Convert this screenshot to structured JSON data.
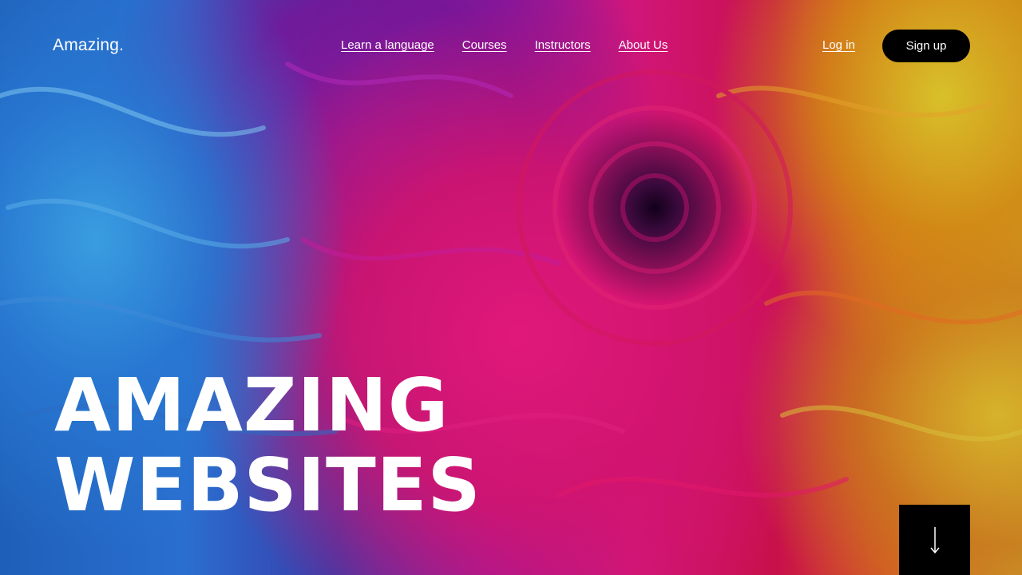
{
  "brand": {
    "logo_text": "Amazing."
  },
  "nav": {
    "items": [
      {
        "label": "Learn a language"
      },
      {
        "label": "Courses"
      },
      {
        "label": "Instructors"
      },
      {
        "label": "About Us"
      }
    ]
  },
  "auth": {
    "login_label": "Log in",
    "signup_label": "Sign up"
  },
  "hero": {
    "headline_line1": "AMAZING",
    "headline_line2": "WEBSITES"
  },
  "scroll_icon": "arrow-down-icon",
  "colors": {
    "text": "#ffffff",
    "button_bg": "#000000"
  }
}
